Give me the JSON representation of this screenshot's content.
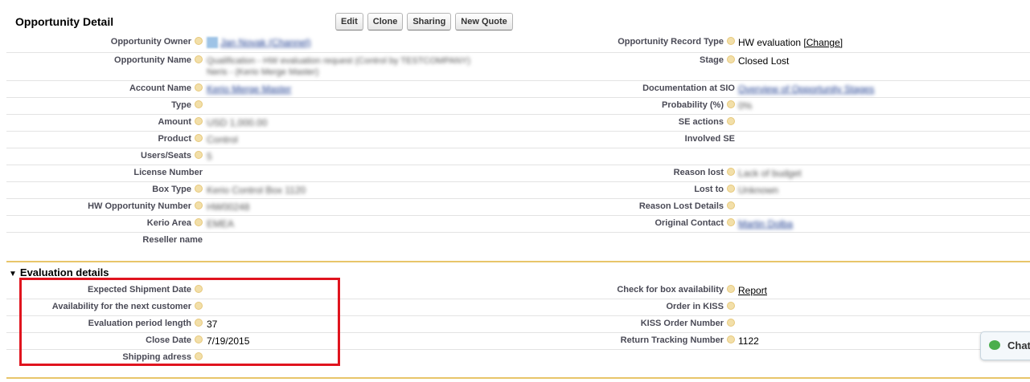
{
  "header": {
    "title": "Opportunity Detail",
    "buttons": [
      "Edit",
      "Clone",
      "Sharing",
      "New Quote"
    ]
  },
  "left_fields": [
    {
      "label": "Opportunity Owner",
      "help": true,
      "value": "Jan Novak (Channel)",
      "blurred": true,
      "link": true,
      "avatar": true
    },
    {
      "label": "Opportunity Name",
      "help": true,
      "value": "Qualification - HW evaluation request (Control by TESTCOMPANY)",
      "value2": "Neris - (Kerio Merge Master)",
      "blurred": true
    },
    {
      "label": "Account Name",
      "help": true,
      "value": "Kerio Merge Master",
      "blurred": true,
      "link": true
    },
    {
      "label": "Type",
      "help": true,
      "value": ""
    },
    {
      "label": "Amount",
      "help": true,
      "value": "USD 1,000.00",
      "blurred": true
    },
    {
      "label": "Product",
      "help": true,
      "value": "Control",
      "blurred": true
    },
    {
      "label": "Users/Seats",
      "help": true,
      "value": "5",
      "blurred": true
    },
    {
      "label": "License Number",
      "help": false,
      "value": ""
    },
    {
      "label": "Box Type",
      "help": true,
      "value": "Kerio Control Box 1120",
      "blurred": true
    },
    {
      "label": "HW Opportunity Number",
      "help": true,
      "value": "HW00248",
      "blurred": true
    },
    {
      "label": "Kerio Area",
      "help": true,
      "value": "EMEA",
      "blurred": true
    },
    {
      "label": "Reseller name",
      "help": false,
      "value": ""
    }
  ],
  "right_fields": [
    {
      "label": "Opportunity Record Type",
      "help": true,
      "value": "HW evaluation",
      "action": "[Change]"
    },
    {
      "label": "Stage",
      "help": true,
      "value": "Closed Lost"
    },
    {
      "label": "Documentation at SIO",
      "help": false,
      "value": "Overview of Opportunity Stages",
      "blurred": true,
      "link": true
    },
    {
      "label": "Probability (%)",
      "help": true,
      "value": "0%",
      "blurred": true
    },
    {
      "label": "SE actions",
      "help": true,
      "value": ""
    },
    {
      "label": "Involved SE",
      "help": false,
      "value": ""
    },
    {
      "label": "Reason lost",
      "help": true,
      "value": "Lack of budget",
      "blurred": true
    },
    {
      "label": "Lost to",
      "help": true,
      "value": "Unknown",
      "blurred": true
    },
    {
      "label": "Reason Lost Details",
      "help": true,
      "value": ""
    },
    {
      "label": "Original Contact",
      "help": true,
      "value": "Martin Dolba",
      "blurred": true,
      "link": true
    }
  ],
  "section": {
    "title": "Evaluation details",
    "left_fields": [
      {
        "label": "Expected Shipment Date",
        "help": true,
        "value": ""
      },
      {
        "label": "Availability for the next customer",
        "help": true,
        "value": ""
      },
      {
        "label": "Evaluation period length",
        "help": true,
        "value": "37"
      },
      {
        "label": "Close Date",
        "help": true,
        "value": "7/19/2015"
      },
      {
        "label": "Shipping adress",
        "help": true,
        "value": ""
      }
    ],
    "right_fields": [
      {
        "label": "Check for box availability",
        "help": true,
        "value": "Report",
        "link": true
      },
      {
        "label": "Order in KISS",
        "help": true,
        "value": ""
      },
      {
        "label": "KISS Order Number",
        "help": true,
        "value": ""
      },
      {
        "label": "Return Tracking Number",
        "help": true,
        "value": "1122"
      }
    ]
  },
  "chat": {
    "label": "Chat"
  },
  "colors": {
    "highlight_box": "#e0141e",
    "section_rule": "#e8c56a",
    "help_icon": "#f2dfa9"
  }
}
